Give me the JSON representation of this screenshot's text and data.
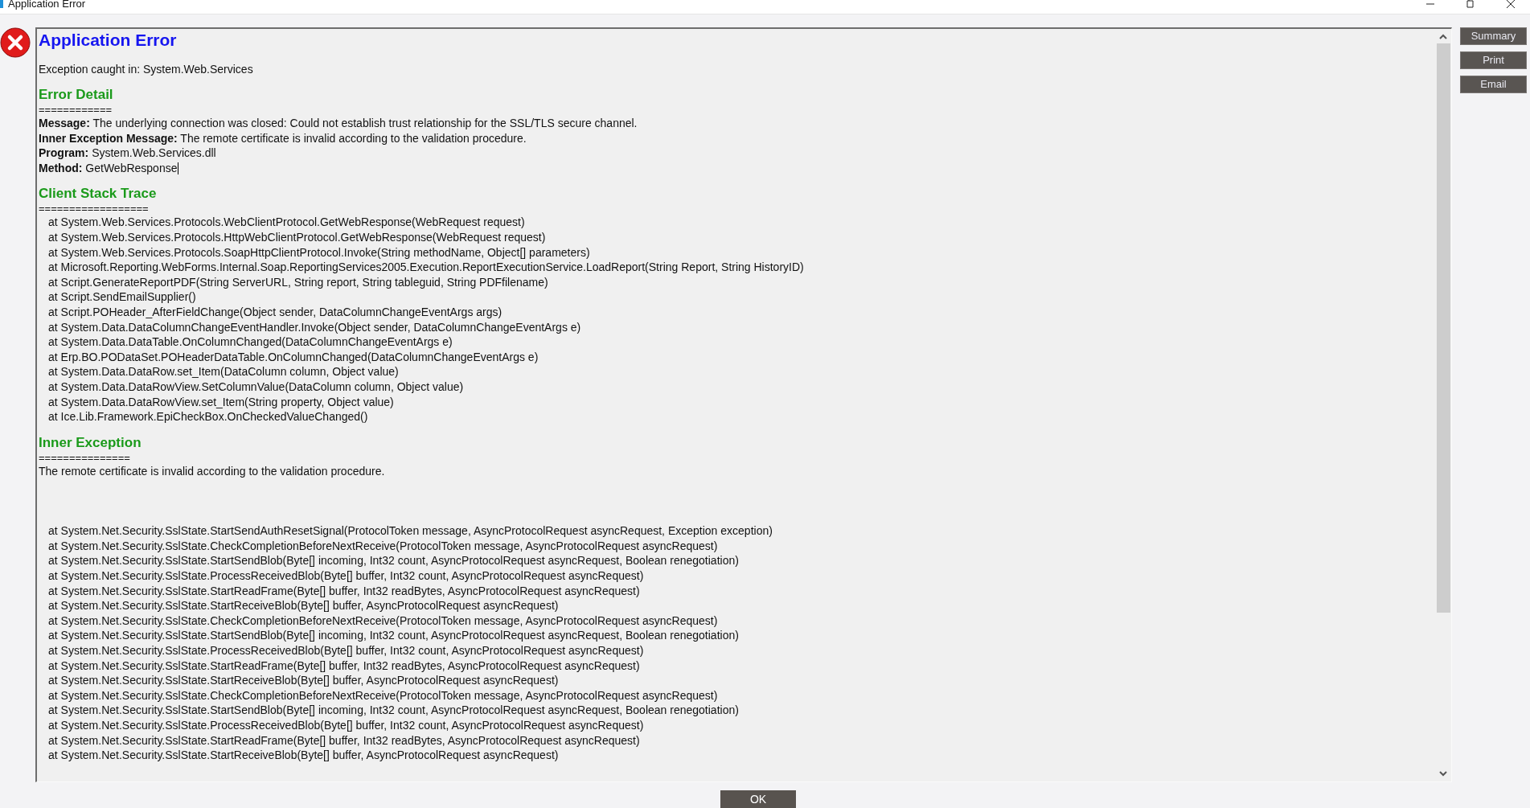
{
  "window": {
    "title": "Application Error"
  },
  "report": {
    "title": "Application Error",
    "caught_in": "Exception caught in: System.Web.Services",
    "error_detail": {
      "heading": "Error Detail",
      "rule": "============",
      "fields": [
        {
          "label": "Message:",
          "value": "The underlying connection was closed: Could not establish trust relationship for the SSL/TLS secure channel."
        },
        {
          "label": "Inner Exception Message:",
          "value": "The remote certificate is invalid according to the validation procedure."
        },
        {
          "label": "Program:",
          "value": "System.Web.Services.dll"
        },
        {
          "label": "Method:",
          "value": "GetWebResponse"
        }
      ]
    },
    "client_stack_trace": {
      "heading": "Client Stack Trace",
      "rule": "==================",
      "lines": [
        "at System.Web.Services.Protocols.WebClientProtocol.GetWebResponse(WebRequest request)",
        "at System.Web.Services.Protocols.HttpWebClientProtocol.GetWebResponse(WebRequest request)",
        "at System.Web.Services.Protocols.SoapHttpClientProtocol.Invoke(String methodName, Object[] parameters)",
        "at Microsoft.Reporting.WebForms.Internal.Soap.ReportingServices2005.Execution.ReportExecutionService.LoadReport(String Report, String HistoryID)",
        "at Script.GenerateReportPDF(String ServerURL, String report, String tableguid, String PDFfilename)",
        "at Script.SendEmailSupplier()",
        "at Script.POHeader_AfterFieldChange(Object sender, DataColumnChangeEventArgs args)",
        "at System.Data.DataColumnChangeEventHandler.Invoke(Object sender, DataColumnChangeEventArgs e)",
        "at System.Data.DataTable.OnColumnChanged(DataColumnChangeEventArgs e)",
        "at Erp.BO.PODataSet.POHeaderDataTable.OnColumnChanged(DataColumnChangeEventArgs e)",
        "at System.Data.DataRow.set_Item(DataColumn column, Object value)",
        "at System.Data.DataRowView.SetColumnValue(DataColumn column, Object value)",
        "at System.Data.DataRowView.set_Item(String property, Object value)",
        "at Ice.Lib.Framework.EpiCheckBox.OnCheckedValueChanged()"
      ]
    },
    "inner_exception": {
      "heading": "Inner Exception",
      "rule": "===============",
      "message": "The remote certificate is invalid according to the validation procedure.",
      "lines": [
        "at System.Net.Security.SslState.StartSendAuthResetSignal(ProtocolToken message, AsyncProtocolRequest asyncRequest, Exception exception)",
        "at System.Net.Security.SslState.CheckCompletionBeforeNextReceive(ProtocolToken message, AsyncProtocolRequest asyncRequest)",
        "at System.Net.Security.SslState.StartSendBlob(Byte[] incoming, Int32 count, AsyncProtocolRequest asyncRequest, Boolean renegotiation)",
        "at System.Net.Security.SslState.ProcessReceivedBlob(Byte[] buffer, Int32 count, AsyncProtocolRequest asyncRequest)",
        "at System.Net.Security.SslState.StartReadFrame(Byte[] buffer, Int32 readBytes, AsyncProtocolRequest asyncRequest)",
        "at System.Net.Security.SslState.StartReceiveBlob(Byte[] buffer, AsyncProtocolRequest asyncRequest)",
        "at System.Net.Security.SslState.CheckCompletionBeforeNextReceive(ProtocolToken message, AsyncProtocolRequest asyncRequest)",
        "at System.Net.Security.SslState.StartSendBlob(Byte[] incoming, Int32 count, AsyncProtocolRequest asyncRequest, Boolean renegotiation)",
        "at System.Net.Security.SslState.ProcessReceivedBlob(Byte[] buffer, Int32 count, AsyncProtocolRequest asyncRequest)",
        "at System.Net.Security.SslState.StartReadFrame(Byte[] buffer, Int32 readBytes, AsyncProtocolRequest asyncRequest)",
        "at System.Net.Security.SslState.StartReceiveBlob(Byte[] buffer, AsyncProtocolRequest asyncRequest)",
        "at System.Net.Security.SslState.CheckCompletionBeforeNextReceive(ProtocolToken message, AsyncProtocolRequest asyncRequest)",
        "at System.Net.Security.SslState.StartSendBlob(Byte[] incoming, Int32 count, AsyncProtocolRequest asyncRequest, Boolean renegotiation)",
        "at System.Net.Security.SslState.ProcessReceivedBlob(Byte[] buffer, Int32 count, AsyncProtocolRequest asyncRequest)",
        "at System.Net.Security.SslState.StartReadFrame(Byte[] buffer, Int32 readBytes, AsyncProtocolRequest asyncRequest)",
        "at System.Net.Security.SslState.StartReceiveBlob(Byte[] buffer, AsyncProtocolRequest asyncRequest)"
      ]
    }
  },
  "side_buttons": [
    "Summary",
    "Print",
    "Email"
  ],
  "ok_button": "OK"
}
